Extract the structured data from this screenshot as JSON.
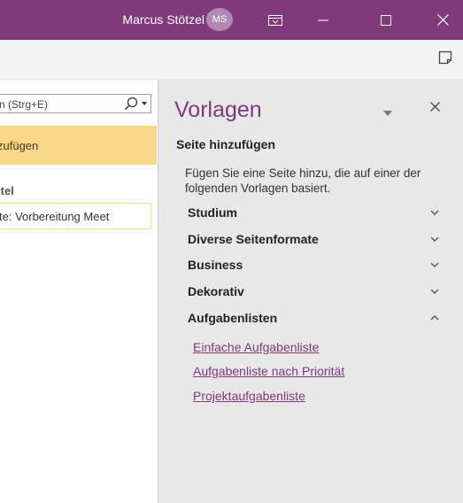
{
  "titlebar": {
    "user_name": "Marcus Stötzel",
    "avatar_initials": "MS",
    "color": "#80397b"
  },
  "left_pane": {
    "search_placeholder": "n (Strg+E)",
    "add_page_label": "zufügen",
    "title_label": "itel",
    "title_value": "te: Vorbereitung Meet",
    "active_color": "#f8d889"
  },
  "templates": {
    "title": "Vorlagen",
    "section_heading": "Seite hinzufügen",
    "description": "Fügen Sie eine Seite hinzu, die auf einer der folgenden Vorlagen basiert.",
    "categories": [
      {
        "label": "Studium",
        "expanded": false
      },
      {
        "label": "Diverse Seitenformate",
        "expanded": false
      },
      {
        "label": "Business",
        "expanded": false
      },
      {
        "label": "Dekorativ",
        "expanded": false
      },
      {
        "label": "Aufgabenlisten",
        "expanded": true
      }
    ],
    "links": [
      "Einfache Aufgabenliste",
      "Aufgabenliste nach Priorität",
      "Projektaufgabenliste"
    ],
    "accent_color": "#80397b"
  },
  "icons": {
    "display_mode": "ribbon-display-icon",
    "minimize": "minimize-icon",
    "maximize": "maximize-icon",
    "close": "close-icon",
    "notes": "sticky-note-icon",
    "search": "search-icon"
  }
}
